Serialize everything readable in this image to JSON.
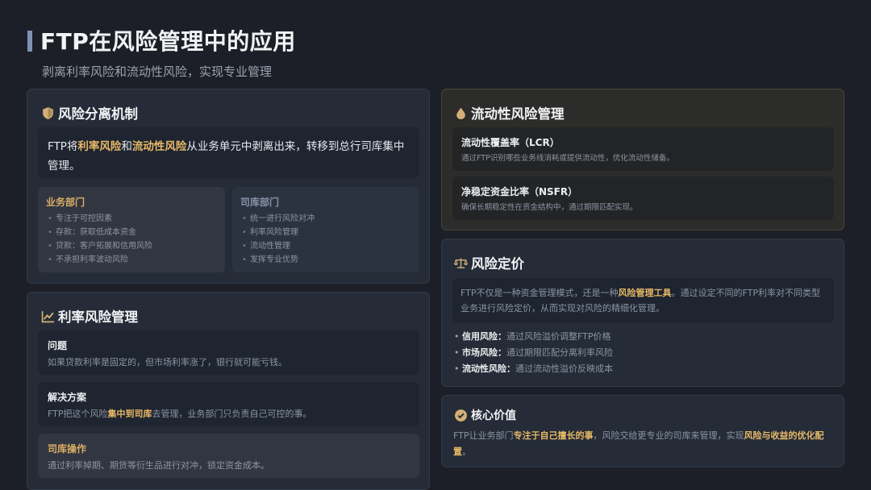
{
  "header": {
    "title": "FTP在风险管理中的应用",
    "subtitle": "剥离利率风险和流动性风险，实现专业管理"
  },
  "separation": {
    "title": "风险分离机制",
    "intro_prefix": "FTP将",
    "intro_hl1": "利率风险",
    "intro_mid": "和",
    "intro_hl2": "流动性风险",
    "intro_suffix": "从业务单元中剥离出来，转移到总行司库集中管理。",
    "business": {
      "title": "业务部门",
      "items": [
        "专注于可控因素",
        "存款：获取低成本资金",
        "贷款：客户拓展和信用风险",
        "不承担利率波动风险"
      ]
    },
    "treasury": {
      "title": "司库部门",
      "items": [
        "统一进行风险对冲",
        "利率风险管理",
        "流动性管理",
        "发挥专业优势"
      ]
    }
  },
  "interest": {
    "title": "利率风险管理",
    "problem_title": "问题",
    "problem_text": "如果贷款利率是固定的，但市场利率涨了，银行就可能亏钱。",
    "solution_title": "解决方案",
    "solution_prefix": "FTP把这个风险",
    "solution_hl": "集中到司库",
    "solution_suffix": "去管理，业务部门只负责自己可控的事。",
    "ops_title": "司库操作",
    "ops_text": "通过利率掉期、期货等衍生品进行对冲，锁定资金成本。"
  },
  "liquidity": {
    "title": "流动性风险管理",
    "lcr_title": "流动性覆盖率（LCR）",
    "lcr_text": "通过FTP识别哪些业务线消耗或提供流动性，优化流动性储备。",
    "nsfr_title": "净稳定资金比率（NSFR）",
    "nsfr_text": "确保长期稳定性在资金结构中，通过期限匹配实现。"
  },
  "pricing": {
    "title": "风险定价",
    "intro_prefix": "FTP不仅是一种资金管理模式，还是一种",
    "intro_hl": "风险管理工具",
    "intro_suffix": "。通过设定不同的FTP利率对不同类型业务进行风险定价，从而实现对风险的精细化管理。",
    "items": [
      {
        "label": "信用风险：",
        "text": "通过风险溢价调整FTP价格"
      },
      {
        "label": "市场风险：",
        "text": "通过期限匹配分离利率风险"
      },
      {
        "label": "流动性风险：",
        "text": "通过流动性溢价反映成本"
      }
    ]
  },
  "core": {
    "title": "核心价值",
    "text_prefix": "FTP让业务部门",
    "text_hl1": "专注于自己擅长的事",
    "text_mid": "，风险交给更专业的司库来管理，实现",
    "text_hl2": "风险与收益的优化配置",
    "text_suffix": "。"
  },
  "colors": {
    "accent": "#e6b866",
    "title_bar": "#7d93b3",
    "background": "#1c1f27"
  }
}
